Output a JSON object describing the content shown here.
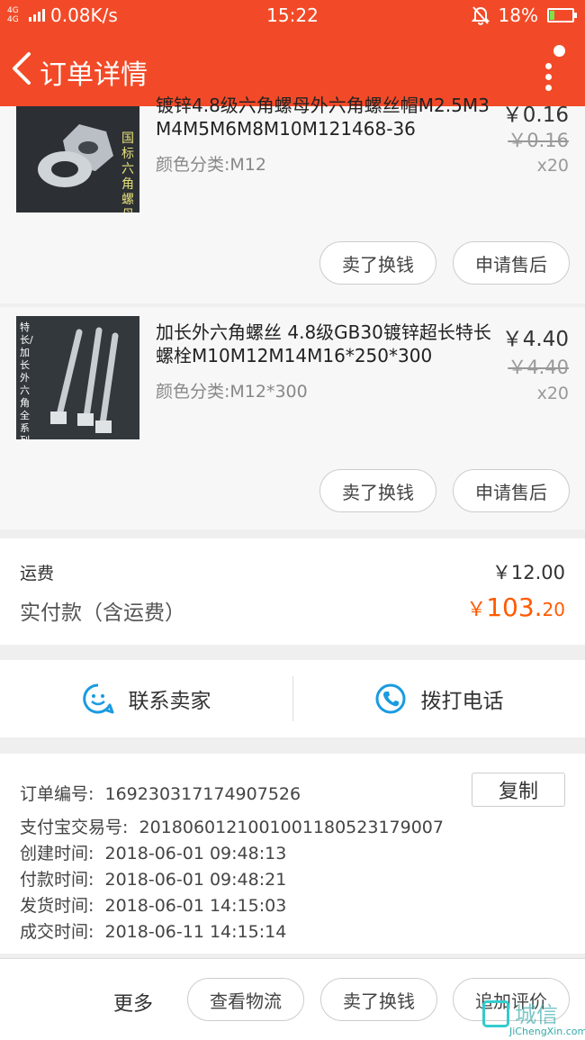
{
  "status_bar": {
    "network": "4G 4G",
    "speed": "0.08K/s",
    "time": "15:22",
    "battery": "18%",
    "battery_level": 0.18
  },
  "header": {
    "title": "订单详情"
  },
  "products": [
    {
      "title": "镀锌4.8级六角螺母外六角螺丝帽M2.5M3M4M5M6M8M10M121468-36",
      "thumb_text": "国标六角螺母",
      "variant": "颜色分类:M12",
      "price": "￥0.16",
      "original_price": "￥0.16",
      "qty": "x20",
      "btn_sell": "卖了换钱",
      "btn_after_sale": "申请售后"
    },
    {
      "title": "加长外六角螺丝 4.8级GB30镀锌超长特长螺栓M10M12M14M16*250*300",
      "thumb_text": "特长/加长外六角全系列",
      "variant": "颜色分类:M12*300",
      "price": "￥4.40",
      "original_price": "￥4.40",
      "qty": "x20",
      "btn_sell": "卖了换钱",
      "btn_after_sale": "申请售后"
    }
  ],
  "summary": {
    "shipping_label": "运费",
    "shipping_value": "￥12.00",
    "paid_label": "实付款（含运费）",
    "paid_currency": "￥",
    "paid_int": "103.",
    "paid_dec": "20"
  },
  "contact": {
    "seller": "联系卖家",
    "phone": "拨打电话"
  },
  "order_info": {
    "copy_label": "复制",
    "rows": [
      {
        "k": "订单编号:",
        "v": "169230317174907526"
      },
      {
        "k": "支付宝交易号:",
        "v": "2018060121001001180523179007"
      },
      {
        "k": "创建时间:",
        "v": "2018-06-01 09:48:13"
      },
      {
        "k": "付款时间:",
        "v": "2018-06-01 09:48:21"
      },
      {
        "k": "发货时间:",
        "v": "2018-06-01 14:15:03"
      },
      {
        "k": "成交时间:",
        "v": "2018-06-11 14:15:14"
      }
    ]
  },
  "bottom": {
    "more": "更多",
    "logistics": "查看物流",
    "sell": "卖了换钱",
    "review": "追加评价"
  },
  "watermark": {
    "text": "城信",
    "site": "JiChengXin.com"
  },
  "colors": {
    "brand": "#f24a28",
    "price_accent": "#ff5a00",
    "icon_blue": "#1a9be0"
  }
}
